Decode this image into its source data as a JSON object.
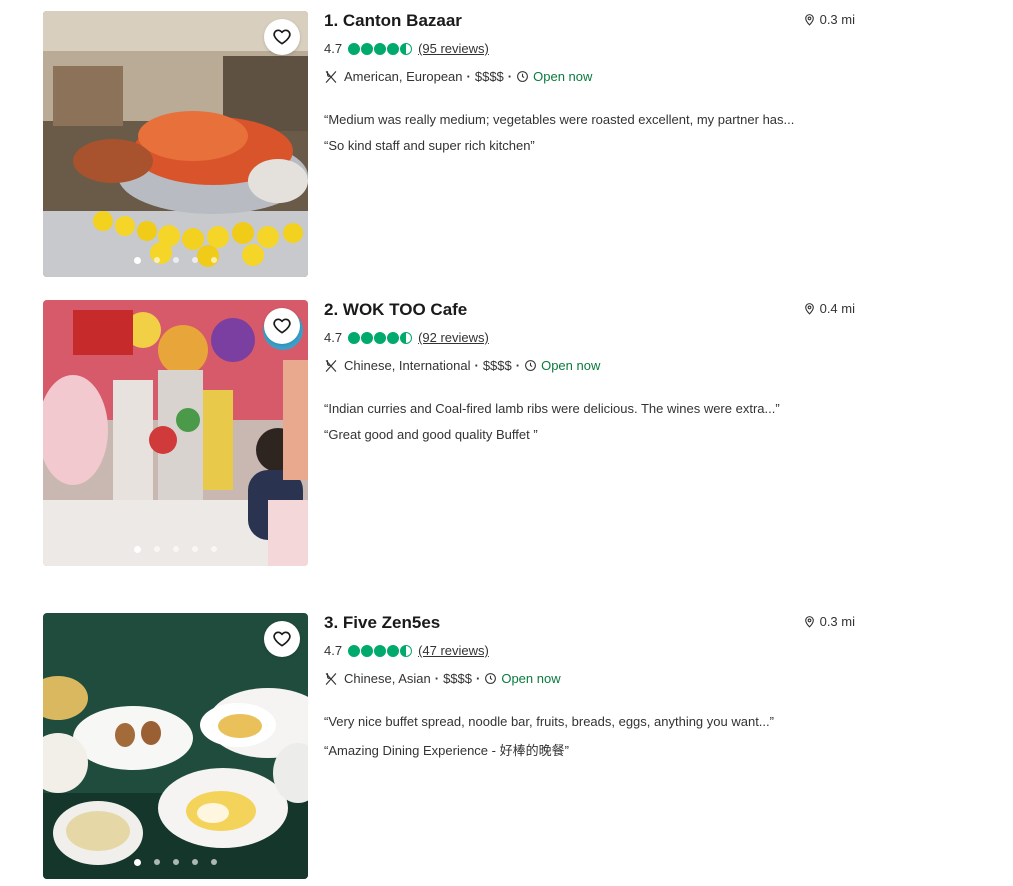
{
  "restaurants": [
    {
      "title": "1. Canton Bazaar",
      "distance": "0.3 mi",
      "rating": "4.7",
      "rating_value": 4.5,
      "reviews": "(95 reviews)",
      "cuisine": "American, European",
      "price": "$$$$",
      "status": "Open now",
      "quote1": "“Medium was really medium; vegetables were roasted excellent, my partner has...",
      "quote2": "“So kind staff and super rich kitchen”",
      "photo_index": 1,
      "photo_count": 5
    },
    {
      "title": "2. WOK TOO Cafe",
      "distance": "0.4 mi",
      "rating": "4.7",
      "rating_value": 4.5,
      "reviews": "(92 reviews)",
      "cuisine": "Chinese, International",
      "price": "$$$$",
      "status": "Open now",
      "quote1": "“Indian curries and Coal-fired lamb ribs were delicious. The wines were extra...”",
      "quote2": "“Great good and good quality Buffet ”",
      "photo_index": 1,
      "photo_count": 5
    },
    {
      "title": "3. Five Zen5es",
      "distance": "0.3 mi",
      "rating": "4.7",
      "rating_value": 4.5,
      "reviews": "(47 reviews)",
      "cuisine": "Chinese, Asian",
      "price": "$$$$",
      "status": "Open now",
      "quote1": "“Very nice buffet spread, noodle bar, fruits, breads, eggs, anything you want...”",
      "quote2": "“Amazing Dining Experience - 好棒的晚餐”",
      "photo_index": 1,
      "photo_count": 5
    }
  ],
  "icons": {
    "favorite": "heart-icon",
    "distance": "map-pin-icon",
    "cuisine": "utensils-icon",
    "hours": "clock-icon"
  },
  "colors": {
    "rating_bubble": "#00aa6c",
    "open_status": "#0a7a3d"
  }
}
